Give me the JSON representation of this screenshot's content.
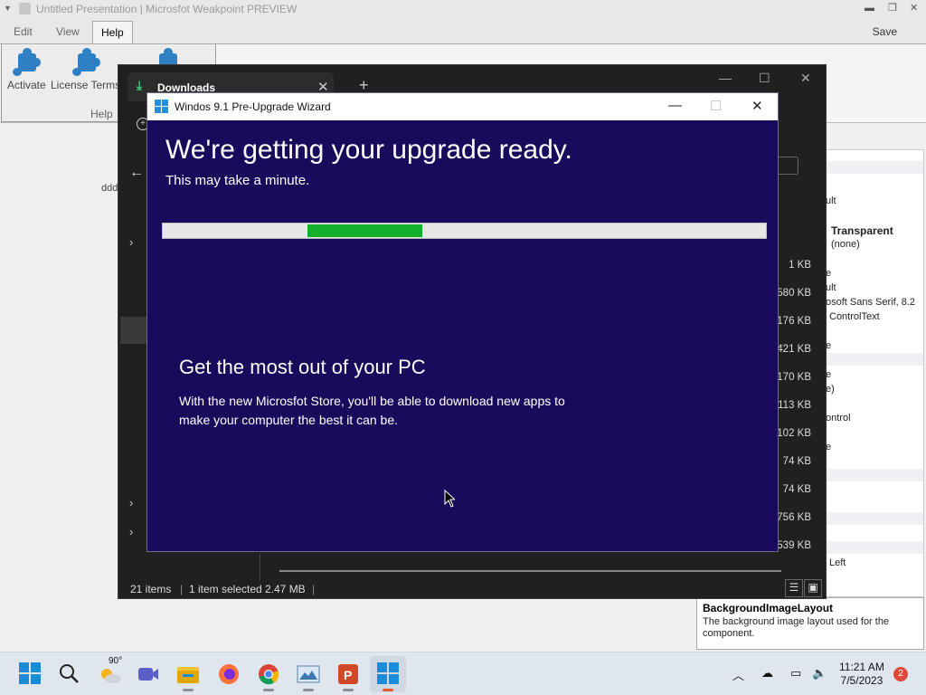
{
  "weakpoint": {
    "title": "Untitled Presentation | Microsfot Weakpoint PREVIEW",
    "menu": {
      "edit": "Edit",
      "view": "View",
      "help": "Help",
      "save": "Save"
    },
    "ribbon": {
      "activate": "Activate",
      "license_terms": "License Terms",
      "group": "Help"
    },
    "canvas_text": "ddd"
  },
  "explorer": {
    "tab_label": "Downloads",
    "sizes": [
      "1 KB",
      ",580 KB",
      ",176 KB",
      ",421 KB",
      ",170 KB",
      ",113 KB",
      ",102 KB",
      "74 KB",
      "74 KB",
      ",756 KB",
      ",539 KB"
    ],
    "status": {
      "items": "21 items",
      "selected": "1 item selected",
      "size": "2.47 MB"
    }
  },
  "properties": {
    "rows": {
      "r1": "ult",
      "transparent": "Transparent",
      "none": "(none)",
      "r4": "e",
      "r5": "ult",
      "font": "osoft Sans Serif, 8.2",
      "control_text": "ControlText",
      "r8": "e",
      "r9": "e",
      "r10": "e)",
      "control": "ontrol",
      "r12": "e",
      "left": "Left"
    },
    "help_title": "BackgroundImageLayout",
    "help_desc": "The background image layout used for the component."
  },
  "wizard": {
    "title": "Windos 9.1 Pre-Upgrade Wizard",
    "heading": "We're getting your upgrade ready.",
    "subheading": "This may take a minute.",
    "progress": {
      "start_fraction": 0.24,
      "end_fraction": 0.43,
      "color": "#13b02c"
    },
    "promo_title": "Get the most out of your PC",
    "promo_body": "With the new Microsfot Store, you'll be able to download new apps to make your computer the best it can be.",
    "background": "#1a0a5c"
  },
  "taskbar": {
    "weather_temp": "90°",
    "time": "11:21 AM",
    "date": "7/5/2023",
    "notification_count": "2",
    "apps": [
      "start-icon",
      "search-icon",
      "weather-icon",
      "meet-icon",
      "file-explorer-icon",
      "firefox-icon",
      "chrome-icon",
      "photos-icon",
      "weakpoint-icon",
      "upgrade-wizard-icon"
    ]
  }
}
